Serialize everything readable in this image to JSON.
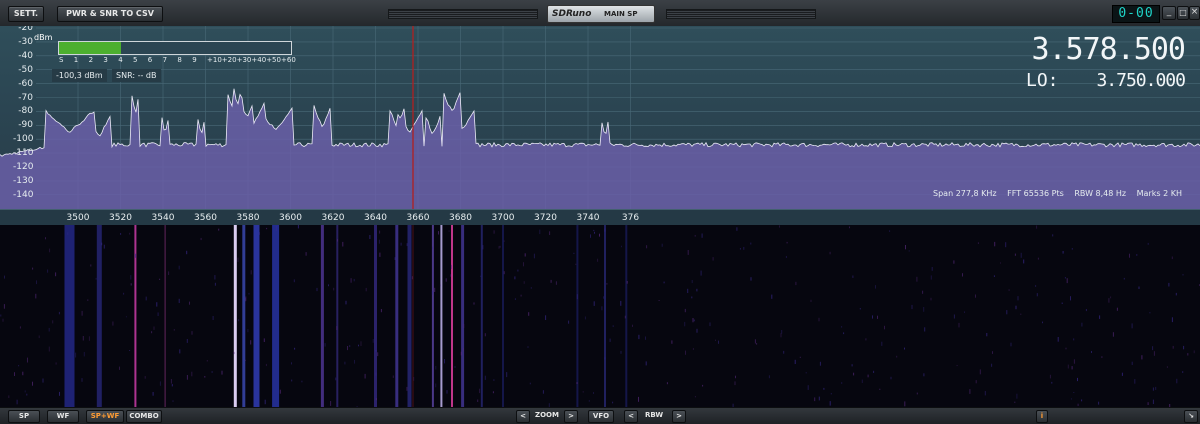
{
  "toolbar": {
    "settings_label": "SETT.",
    "export_label": "PWR & SNR TO CSV",
    "brand": "SDRuno",
    "window_name": "MAIN SP",
    "clock": "0-00",
    "min_glyph": "_",
    "max_glyph": "□",
    "close_glyph": "×"
  },
  "spectrum": {
    "y_unit": "dBm",
    "y_labels": [
      "-20",
      "-30",
      "-40",
      "-50",
      "-60",
      "-70",
      "-80",
      "-90",
      "-100",
      "-110",
      "-120",
      "-130",
      "-140"
    ],
    "x_labels": [
      "3500",
      "3520",
      "3540",
      "3560",
      "3580",
      "3600",
      "3620",
      "3640",
      "3660",
      "3680",
      "3700",
      "3720",
      "3740",
      "376"
    ],
    "smeter": {
      "scale": [
        "S",
        "1",
        "2",
        "3",
        "4",
        "5",
        "6",
        "7",
        "8",
        "9",
        "+10",
        "+20",
        "+30",
        "+40",
        "+50",
        "+60"
      ],
      "level_s": 5,
      "power": "-100,3 dBm",
      "snr": "SNR: -- dB"
    },
    "frequency": "3.578.500",
    "lo_label": "LO:",
    "lo_frequency": "3.750.000",
    "span": "Span 277,8 KHz",
    "fft": "FFT 65536 Pts",
    "rbw": "RBW 8,48 Hz",
    "marks": "Marks 2 KH"
  },
  "bottom": {
    "sp": "SP",
    "wf": "WF",
    "spwf": "SP+WF",
    "combo": "COMBO",
    "zoom_left": "<",
    "zoom": "ZOOM",
    "zoom_right": ">",
    "vfo": "VFO",
    "rbw_left": "<",
    "rbw": "RBW",
    "rbw_right": ">",
    "info": "i",
    "resize": "↘"
  },
  "colors": {
    "spectrum_bg": "#2b4552",
    "trace_fill": "#6a5fa8",
    "smeter_fill": "#4caf2f",
    "clock": "#1fd4c8",
    "tuning_line": "#b02020",
    "active_button": "#ff9c33"
  }
}
